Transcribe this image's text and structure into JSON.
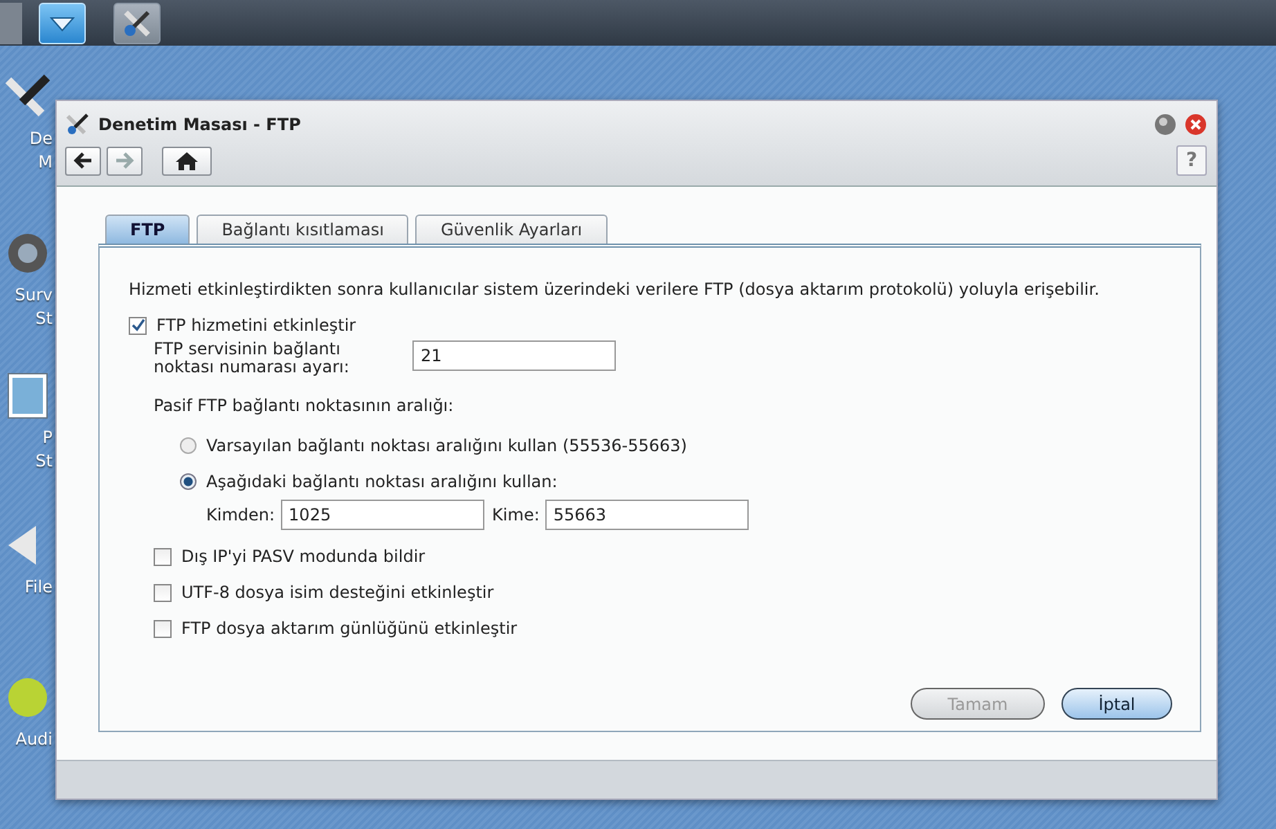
{
  "taskbar": {
    "buttons": [
      {
        "kind": "menu",
        "selected": true
      },
      {
        "kind": "tools",
        "selected": false
      }
    ]
  },
  "desktop_icons": [
    {
      "kind": "tools",
      "lines": [
        "De",
        "M"
      ]
    },
    {
      "kind": "camera",
      "lines": [
        "Surv",
        "St"
      ]
    },
    {
      "kind": "photo",
      "lines": [
        "P",
        "St"
      ]
    },
    {
      "kind": "arrow",
      "lines": [
        "File"
      ]
    },
    {
      "kind": "ball",
      "lines": [
        "Audi"
      ]
    }
  ],
  "window": {
    "title": "Denetim Masası - FTP",
    "nav": [
      {
        "kind": "back",
        "disabled": false
      },
      {
        "kind": "forward",
        "disabled": true
      },
      {
        "kind": "home",
        "disabled": false
      }
    ],
    "help": "?",
    "tabs": [
      {
        "label": "FTP",
        "selected": true
      },
      {
        "label": "Bağlantı kısıtlaması",
        "selected": false
      },
      {
        "label": "Güvenlik Ayarları",
        "selected": false
      }
    ],
    "description": "Hizmeti etkinleştirdikten sonra kullanıcılar sistem üzerindeki verilere FTP (dosya aktarım protokolü) yoluyla erişebilir.",
    "enable_ftp": {
      "label": "FTP hizmetini etkinleştir",
      "checked": true
    },
    "port": {
      "label": "FTP servisinin bağlantı\nnoktası numarası ayarı:",
      "value": "21"
    },
    "passive_label": "Pasif FTP bağlantı noktasının aralığı:",
    "radios": [
      {
        "label": "Varsayılan bağlantı noktası aralığını kullan (55536-55663)",
        "selected": false
      },
      {
        "label": "Aşağıdaki bağlantı noktası aralığını kullan:",
        "selected": true
      }
    ],
    "range": {
      "from_label": "Kimden:",
      "from_value": "1025",
      "to_label": "Kime:",
      "to_value": "55663"
    },
    "options": [
      {
        "label": "Dış IP'yi PASV modunda bildir",
        "checked": false
      },
      {
        "label": "UTF-8 dosya isim desteğini etkinleştir",
        "checked": false
      },
      {
        "label": "FTP dosya aktarım günlüğünü etkinleştir",
        "checked": false
      }
    ],
    "buttons": [
      {
        "label": "Tamam",
        "disabled": true
      },
      {
        "label": "İptal",
        "disabled": false
      }
    ]
  }
}
